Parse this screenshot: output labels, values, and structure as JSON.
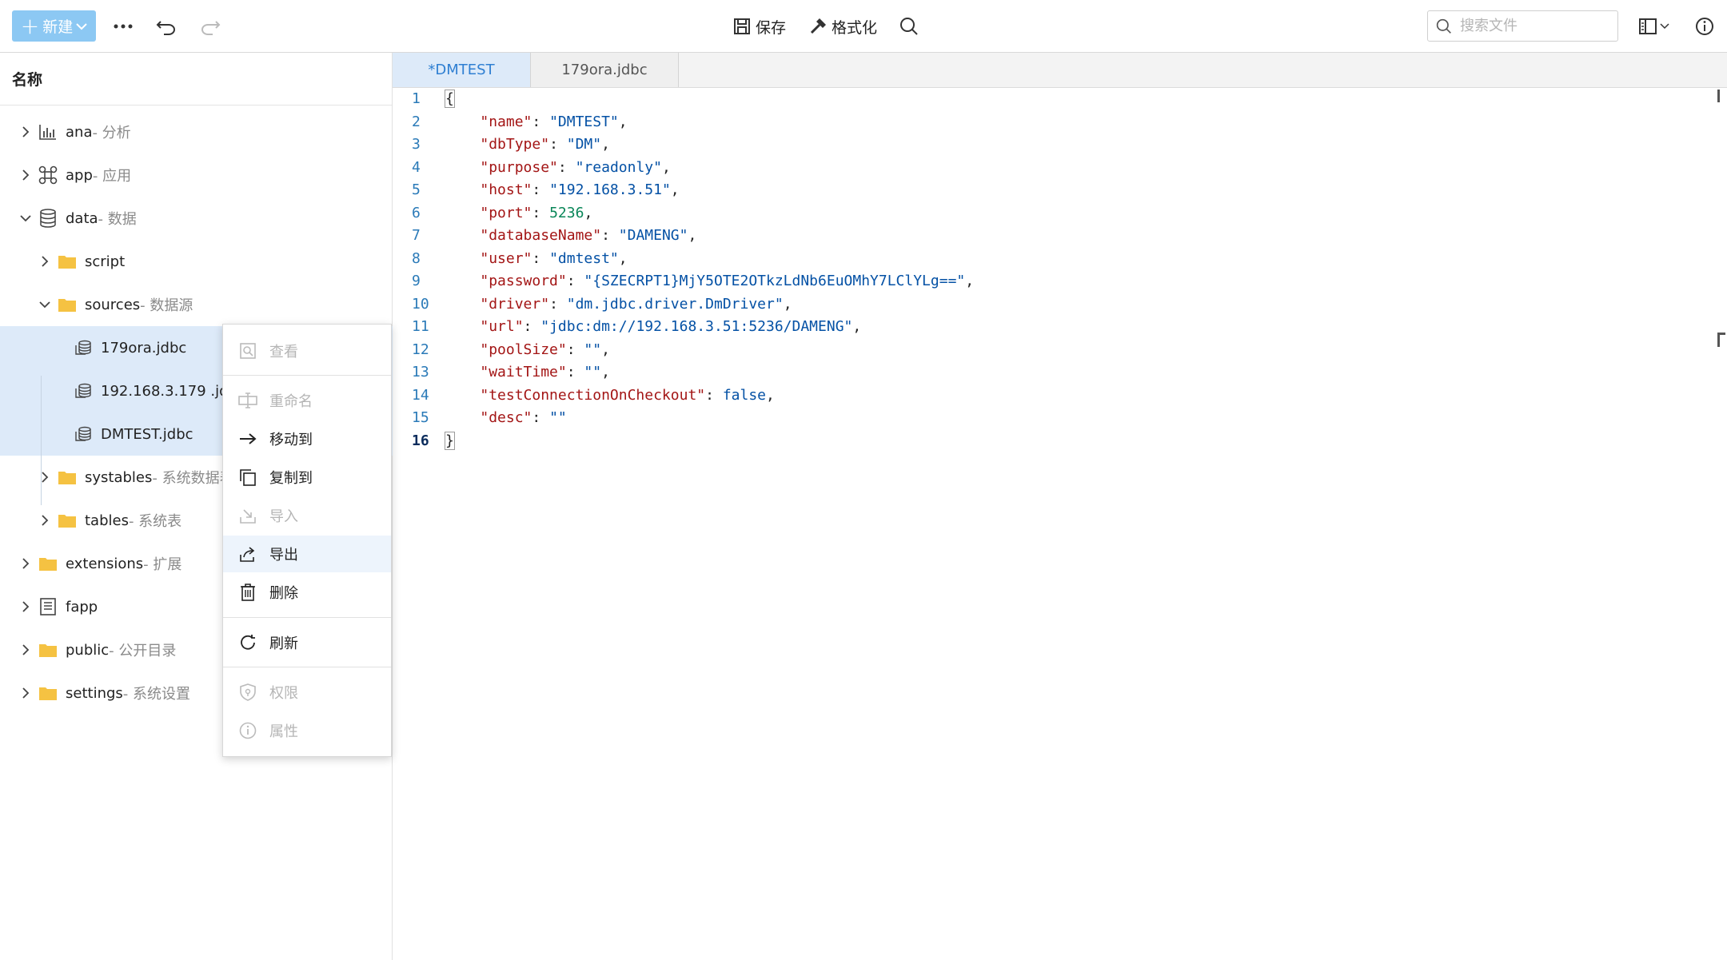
{
  "toolbar": {
    "new_label": "新建",
    "save_label": "保存",
    "format_label": "格式化",
    "search_placeholder": "搜索文件"
  },
  "sidebar": {
    "header": "名称",
    "tree": [
      {
        "name": "ana",
        "desc": " - 分析"
      },
      {
        "name": "app",
        "desc": " - 应用"
      },
      {
        "name": "data",
        "desc": " - 数据"
      },
      {
        "name": "script",
        "desc": ""
      },
      {
        "name": "sources",
        "desc": " - 数据源"
      },
      {
        "name": "179ora.jdbc",
        "desc": ""
      },
      {
        "name": "192.168.3.179 .jdbc",
        "desc": ""
      },
      {
        "name": "DMTEST.jdbc",
        "desc": ""
      },
      {
        "name": "systables",
        "desc": " - 系统数据表"
      },
      {
        "name": "tables",
        "desc": " - 系统表"
      },
      {
        "name": "extensions",
        "desc": " - 扩展"
      },
      {
        "name": "fapp",
        "desc": ""
      },
      {
        "name": "public",
        "desc": " - 公开目录"
      },
      {
        "name": "settings",
        "desc": " - 系统设置"
      }
    ]
  },
  "tabs": [
    {
      "label": "*DMTEST"
    },
    {
      "label": "179ora.jdbc"
    }
  ],
  "editor": {
    "lines": [
      {
        "no": "1",
        "key": "",
        "val": "",
        "post": ""
      },
      {
        "no": "2",
        "key": "\"name\"",
        "val": "\"DMTEST\"",
        "post": ","
      },
      {
        "no": "3",
        "key": "\"dbType\"",
        "val": "\"DM\"",
        "post": ","
      },
      {
        "no": "4",
        "key": "\"purpose\"",
        "val": "\"readonly\"",
        "post": ","
      },
      {
        "no": "5",
        "key": "\"host\"",
        "val": "\"192.168.3.51\"",
        "post": ","
      },
      {
        "no": "6",
        "key": "\"port\"",
        "val": "5236",
        "post": ","
      },
      {
        "no": "7",
        "key": "\"databaseName\"",
        "val": "\"DAMENG\"",
        "post": ","
      },
      {
        "no": "8",
        "key": "\"user\"",
        "val": "\"dmtest\"",
        "post": ","
      },
      {
        "no": "9",
        "key": "\"password\"",
        "val": "\"{SZECRPT1}MjY5OTE2OTkzLdNb6EuOMhY7LClYLg==\"",
        "post": ","
      },
      {
        "no": "10",
        "key": "\"driver\"",
        "val": "\"dm.jdbc.driver.DmDriver\"",
        "post": ","
      },
      {
        "no": "11",
        "key": "\"url\"",
        "val": "\"jdbc:dm://192.168.3.51:5236/DAMENG\"",
        "post": ","
      },
      {
        "no": "12",
        "key": "\"poolSize\"",
        "val": "\"\"",
        "post": ","
      },
      {
        "no": "13",
        "key": "\"waitTime\"",
        "val": "\"\"",
        "post": ","
      },
      {
        "no": "14",
        "key": "\"testConnectionOnCheckout\"",
        "val": "false",
        "post": ","
      },
      {
        "no": "15",
        "key": "\"desc\"",
        "val": "\"\"",
        "post": ""
      },
      {
        "no": "16",
        "key": "",
        "val": "",
        "post": ""
      }
    ]
  },
  "context_menu": {
    "items": [
      {
        "label": "查看",
        "icon": "view-icon"
      },
      {
        "label": "重命名",
        "icon": "rename-icon"
      },
      {
        "label": "移动到",
        "icon": "arrow-right-icon"
      },
      {
        "label": "复制到",
        "icon": "copy-icon"
      },
      {
        "label": "导入",
        "icon": "import-icon"
      },
      {
        "label": "导出",
        "icon": "export-icon"
      },
      {
        "label": "删除",
        "icon": "trash-icon"
      },
      {
        "label": "刷新",
        "icon": "refresh-icon"
      },
      {
        "label": "权限",
        "icon": "shield-icon"
      },
      {
        "label": "属性",
        "icon": "info-icon"
      }
    ]
  },
  "colors": {
    "accent": "#2f7fd2",
    "new_button": "#8cc8f3",
    "selection": "#ddeaf9",
    "folder": "#f5c242"
  }
}
